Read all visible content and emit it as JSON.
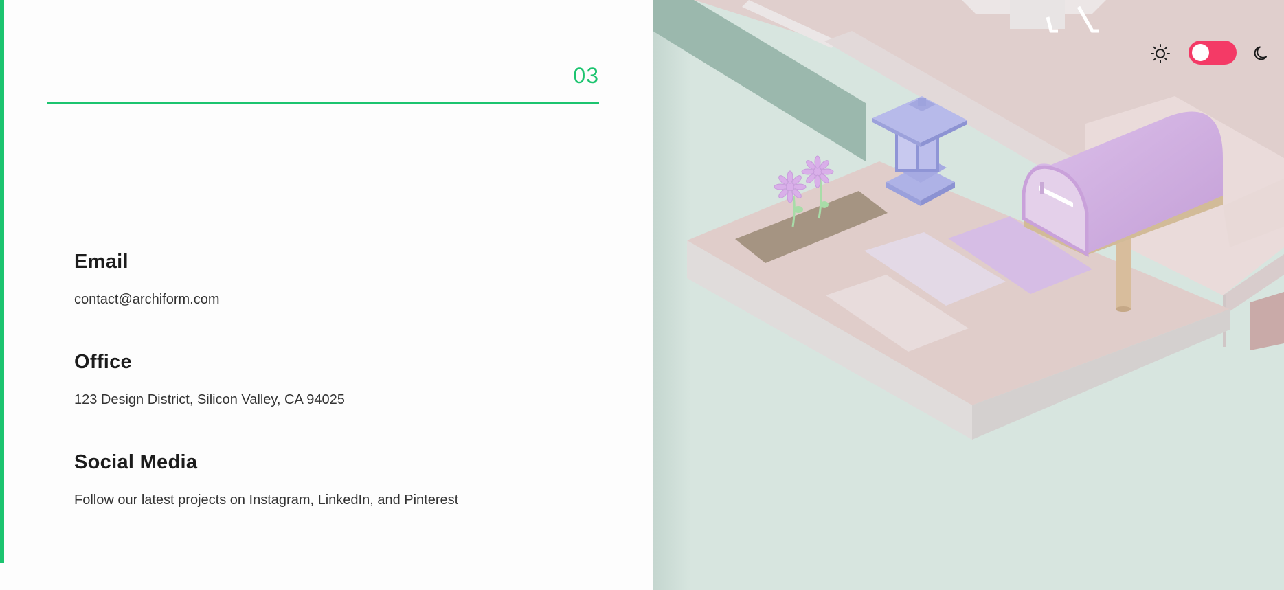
{
  "section": {
    "number": "03"
  },
  "contact": {
    "email": {
      "heading": "Email",
      "value": "contact@archiform.com"
    },
    "office": {
      "heading": "Office",
      "value": "123 Design District, Silicon Valley, CA 94025"
    },
    "social": {
      "heading": "Social Media",
      "value": "Follow our latest projects on Instagram, LinkedIn, and Pinterest"
    }
  },
  "theme_toggle": {
    "light_icon": "sun-icon",
    "dark_icon": "moon-icon",
    "state": "light",
    "track_color": "#f43a66"
  },
  "colors": {
    "accent": "#1cc46f",
    "ground": "#d7e5df",
    "platform": "#dfcdcb",
    "mailbox": "#d6b2e2",
    "lantern": "#b2b5e8"
  },
  "scene": {
    "subject": "isometric 3D garden entrance with lantern, flowers, stepping stones and mailbox",
    "icons": [
      "lantern-model",
      "flower-model",
      "mailbox-model",
      "stepping-stone",
      "planter-bed"
    ]
  }
}
